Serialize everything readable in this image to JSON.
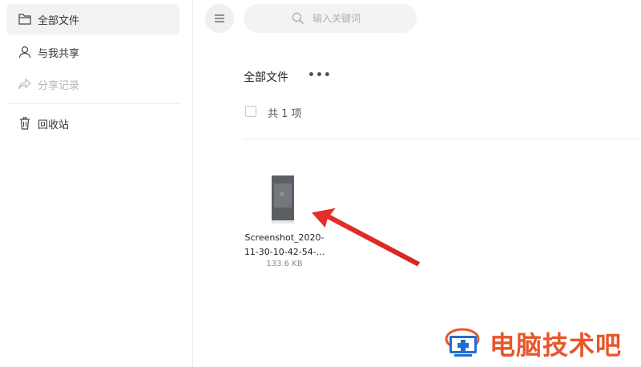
{
  "sidebar": {
    "items": [
      {
        "label": "全部文件",
        "icon": "folder-icon",
        "active": true
      },
      {
        "label": "与我共享",
        "icon": "user-icon"
      },
      {
        "label": "分享记录",
        "icon": "share-icon",
        "disabled": true
      },
      {
        "label": "回收站",
        "icon": "trash-icon"
      }
    ]
  },
  "toolbar": {
    "menu_icon": "menu-icon",
    "search_placeholder": "输入关键词",
    "search_value": ""
  },
  "main": {
    "title": "全部文件",
    "more": "•••",
    "count_text": "共 1 项",
    "files": [
      {
        "name_line1": "Screenshot_2020-",
        "name_line2": "11-30-10-42-54-...",
        "size": "133.6 KB"
      }
    ]
  },
  "watermark": {
    "text": "电脑技术吧"
  },
  "colors": {
    "accent": "#e8302a",
    "watermark": "#e8562a",
    "active_bg": "#f2f2f2"
  }
}
